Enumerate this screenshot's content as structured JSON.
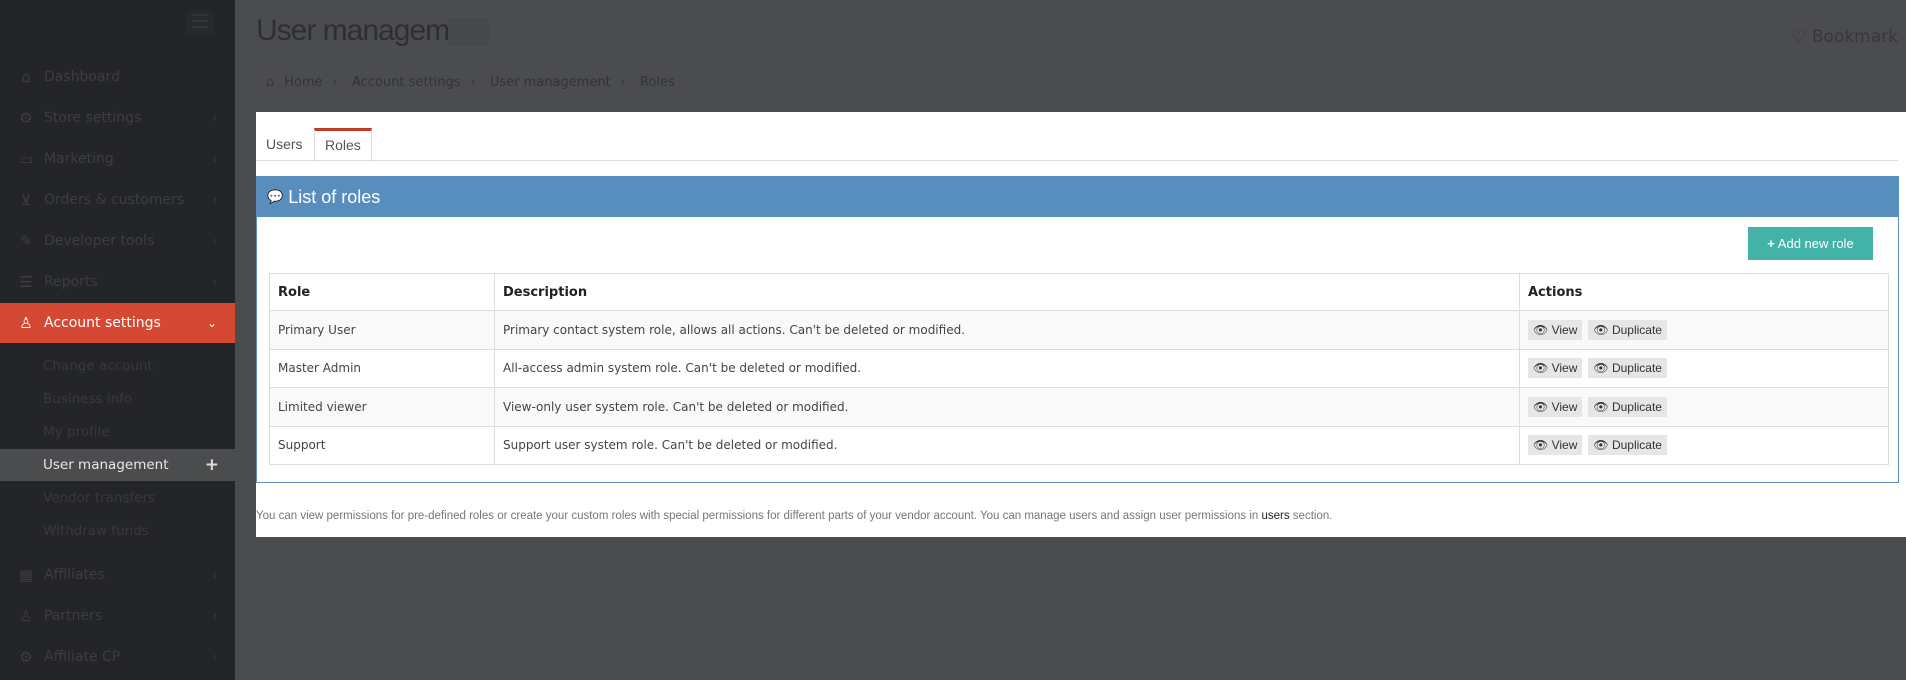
{
  "sidebar": {
    "items": [
      {
        "label": "Dashboard",
        "icon": "home-icon"
      },
      {
        "label": "Store settings",
        "icon": "gear-icon"
      },
      {
        "label": "Marketing",
        "icon": "card-icon"
      },
      {
        "label": "Orders & customers",
        "icon": "cart-icon"
      },
      {
        "label": "Developer tools",
        "icon": "wrench-icon"
      },
      {
        "label": "Reports",
        "icon": "list-icon"
      },
      {
        "label": "Account settings",
        "icon": "user-icon"
      }
    ],
    "subitems": [
      "Change account",
      "Business info",
      "My profile",
      "User management",
      "Vendor transfers",
      "Withdraw funds"
    ],
    "bottom": [
      {
        "label": "Affiliates",
        "icon": "grid-icon"
      },
      {
        "label": "Partners",
        "icon": "people-icon"
      },
      {
        "label": "Affiliate CP",
        "icon": "gear-icon"
      }
    ]
  },
  "header": {
    "title": "User managem",
    "bookmark": "Bookmark"
  },
  "breadcrumb": [
    "Home",
    "Account settings",
    "User management",
    "Roles"
  ],
  "tabs": [
    "Users",
    "Roles"
  ],
  "box": {
    "title": "List of roles",
    "add_button": "Add new role"
  },
  "table": {
    "columns": [
      "Role",
      "Description",
      "Actions"
    ],
    "rows": [
      {
        "role": "Primary User",
        "description": "Primary contact system role, allows all actions. Can't be deleted or modified."
      },
      {
        "role": "Master Admin",
        "description": "All-access admin system role. Can't be deleted or modified."
      },
      {
        "role": "Limited viewer",
        "description": "View-only user system role. Can't be deleted or modified."
      },
      {
        "role": "Support",
        "description": "Support user system role. Can't be deleted or modified."
      }
    ],
    "view_label": "View",
    "duplicate_label": "Duplicate"
  },
  "footer": {
    "text": "You can view permissions for pre-defined roles or create your custom roles with special permissions for different parts of your vendor account. You can manage users and assign user permissions in ",
    "link": "users",
    "suffix": " section."
  },
  "colors": {
    "accent": "#d44834",
    "header": "#588ebe",
    "add_button": "#43b3a8"
  }
}
